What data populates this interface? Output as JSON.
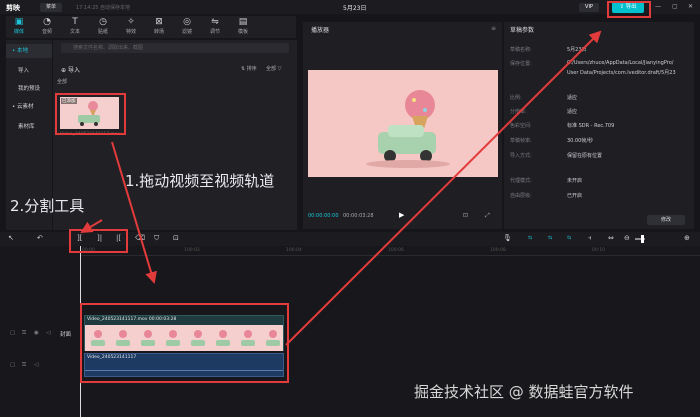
{
  "titlebar": {
    "logo": "剪映",
    "menu_label": "菜单",
    "status_text": "17:14:25 自动保存本地",
    "project_title": "5月23日",
    "vip_label": "VIP",
    "export_label": "导出"
  },
  "toolbar": {
    "items": [
      {
        "label": "媒体",
        "icon": "media-icon"
      },
      {
        "label": "音频",
        "icon": "audio-icon"
      },
      {
        "label": "文本",
        "icon": "text-icon"
      },
      {
        "label": "贴纸",
        "icon": "sticker-icon"
      },
      {
        "label": "特效",
        "icon": "effect-icon"
      },
      {
        "label": "转场",
        "icon": "transition-icon"
      },
      {
        "label": "滤镜",
        "icon": "filter-icon"
      },
      {
        "label": "调节",
        "icon": "adjust-icon"
      },
      {
        "label": "模板",
        "icon": "template-icon"
      }
    ]
  },
  "sidebar": {
    "items": [
      {
        "label": "• 本地"
      },
      {
        "label": "导入"
      },
      {
        "label": "我的预设"
      },
      {
        "label": "• 云素材"
      },
      {
        "label": "素材库"
      }
    ]
  },
  "media": {
    "search_placeholder": "搜索文件名称、调取出来、截图",
    "import_label": "导入",
    "sort_label": "排序",
    "filter_label": "全部",
    "section_label": "全部",
    "clip_badge": "已添加",
    "clip_name": "Video_240523141117.mov"
  },
  "player": {
    "title": "播放器",
    "current_time": "00:00:00:00",
    "duration": "00:00:03:28"
  },
  "properties": {
    "title": "草稿参数",
    "rows": [
      {
        "key": "草稿名称:",
        "value": "5月23日"
      },
      {
        "key": "保存位置:",
        "value": "C:/Users/zhuce/AppData/Local/JianyingPro/"
      },
      {
        "key": "",
        "value": "User Data/Projects/com.lveditor.draft/5月23"
      },
      {
        "key": "比例:",
        "value": "适应"
      },
      {
        "key": "分辨率:",
        "value": "适应"
      },
      {
        "key": "色彩空间:",
        "value": "标准 SDR - Rec.709"
      },
      {
        "key": "草稿帧率:",
        "value": "30.00帧/秒"
      },
      {
        "key": "导入方式:",
        "value": "保留在原有位置"
      },
      {
        "key": "代理模式:",
        "value": "未开启"
      },
      {
        "key": "自由层级:",
        "value": "已开启"
      }
    ],
    "modify_label": "修改"
  },
  "timeline": {
    "ticks": [
      "00:00",
      "100:02",
      "100:04",
      "100:06",
      "100:08",
      "00:10"
    ],
    "cover_label": "封面",
    "video_clip_label": "Video_240523141117.mov  00:00:03:28",
    "audio_clip_label": "Video_240523141117"
  },
  "annotations": {
    "drag_hint": "1.拖动视频至视频轨道",
    "split_hint": "2.分割工具"
  },
  "watermark": "掘金技术社区 @ 数据蛙官方软件",
  "colors": {
    "accent": "#1ec5d9",
    "highlight_box": "#e23b3b",
    "export_bg": "#00c1cd",
    "video_track": "#1f3b3f",
    "audio_track": "#1d3a63"
  }
}
